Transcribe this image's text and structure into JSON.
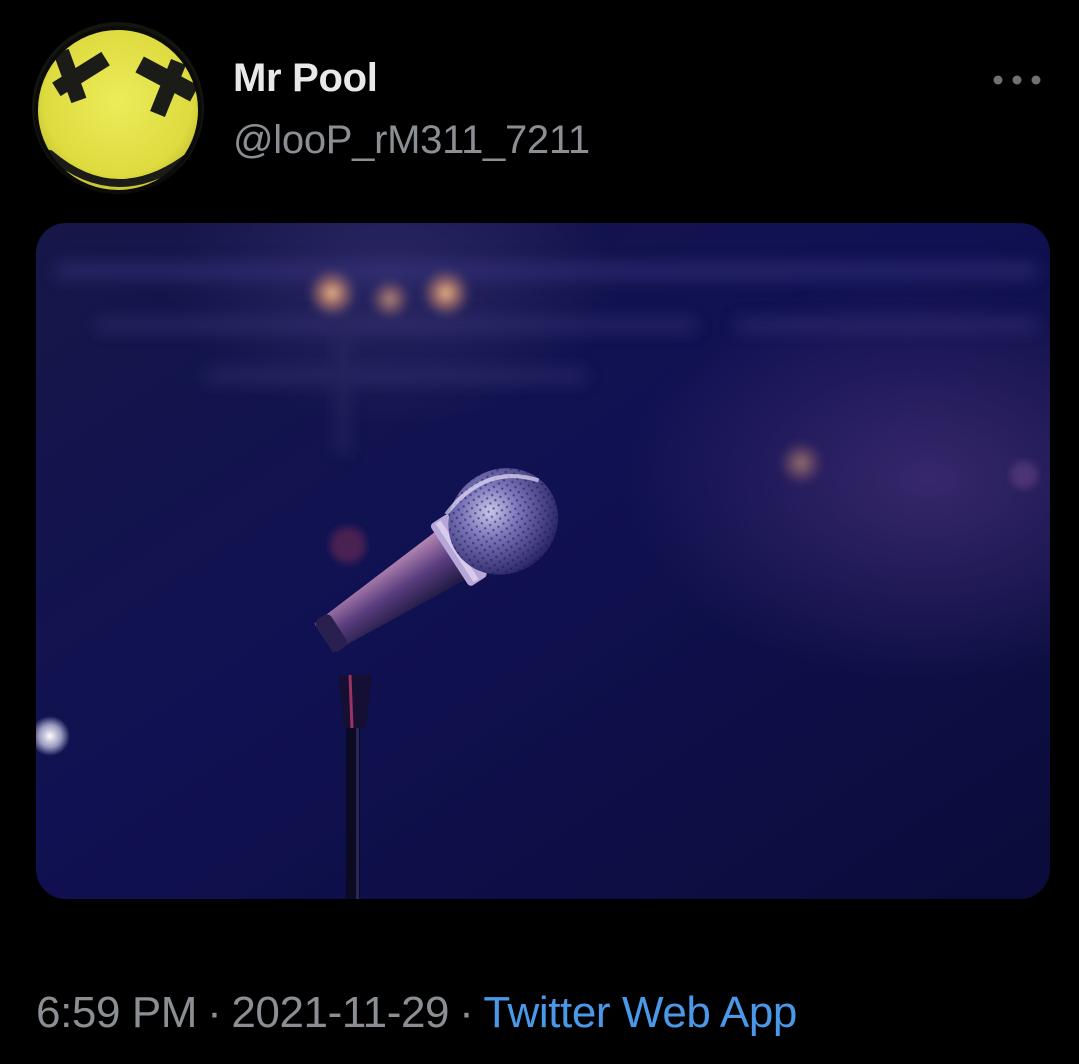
{
  "tweet": {
    "author": {
      "display_name": "Mr Pool",
      "handle": "@looP_rM311_7211",
      "avatar_icon": "yellow-smiley-avatar"
    },
    "more_icon": "more-horizontal-icon",
    "media": {
      "kind": "photo",
      "subject": "microphone-on-stand-icon"
    },
    "time": "6:59 PM",
    "separator": "·",
    "date": "2021-11-29",
    "source": "Twitter Web App"
  },
  "colors": {
    "background": "#000000",
    "display_name": "#e9e9e9",
    "secondary_text": "#8b8f94",
    "link": "#4a99e9",
    "avatar": "#e5e24a",
    "media_base": "#0e0f45"
  }
}
